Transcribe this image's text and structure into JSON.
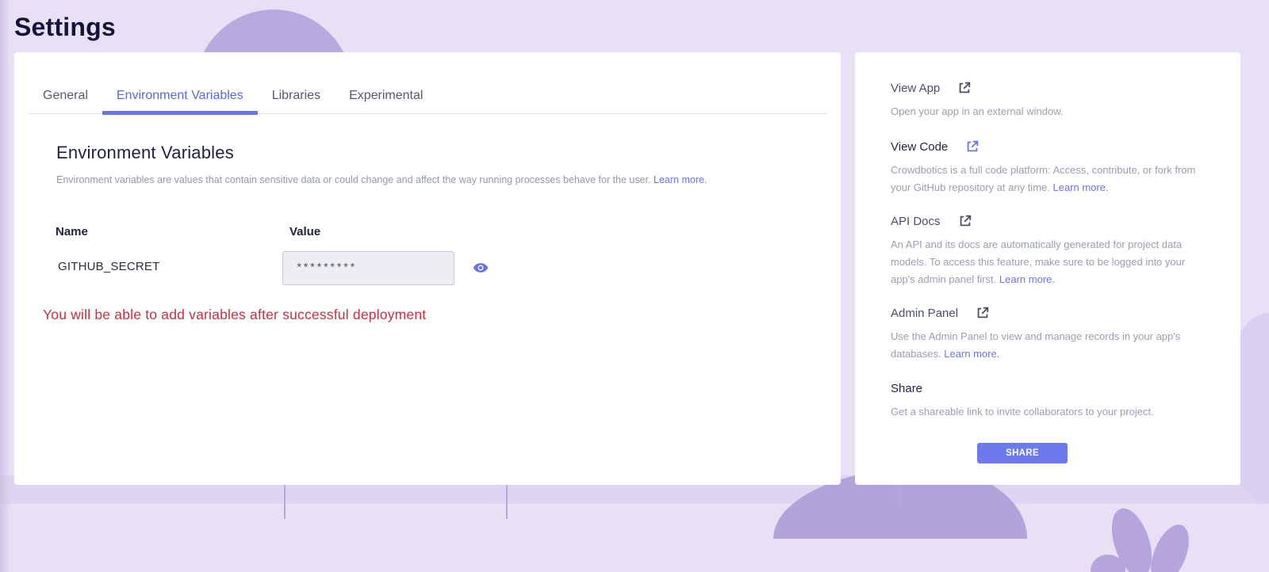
{
  "page": {
    "title": "Settings"
  },
  "tabs": [
    {
      "label": "General",
      "active": false
    },
    {
      "label": "Environment Variables",
      "active": true
    },
    {
      "label": "Libraries",
      "active": false
    },
    {
      "label": "Experimental",
      "active": false
    }
  ],
  "env": {
    "title": "Environment Variables",
    "description": "Environment variables are values that contain sensitive data or could change and affect the way running processes behave for the user.",
    "learn_more": "Learn more.",
    "columns": {
      "name": "Name",
      "value": "Value"
    },
    "variables": [
      {
        "name": "GITHUB_SECRET",
        "value": "*********"
      }
    ],
    "warning": "You will be able to add variables after successful deployment"
  },
  "sidebar": {
    "view_app": {
      "title": "View App",
      "description": "Open your app in an external window."
    },
    "view_code": {
      "title": "View Code",
      "description": "Crowdbotics is a full code platform: Access, contribute, or fork from your GitHub repository at any time.",
      "link": "Learn more."
    },
    "api_docs": {
      "title": "API Docs",
      "description": "An API and its docs are automatically generated for project data models. To access this feature, make sure to be logged into your app's admin panel first.",
      "link": "Learn more."
    },
    "admin_panel": {
      "title": "Admin Panel",
      "description": "Use the Admin Panel to view and manage records in your app's databases.",
      "link": "Learn more."
    },
    "share": {
      "title": "Share",
      "description": "Get a shareable link to invite collaborators to your project.",
      "button": "SHARE"
    }
  },
  "colors": {
    "accent": "#6b74e6",
    "warning": "#c53043",
    "background": "#e8e1f6"
  },
  "icons": {
    "external_link": "external-link-icon",
    "reveal": "eye-icon"
  }
}
